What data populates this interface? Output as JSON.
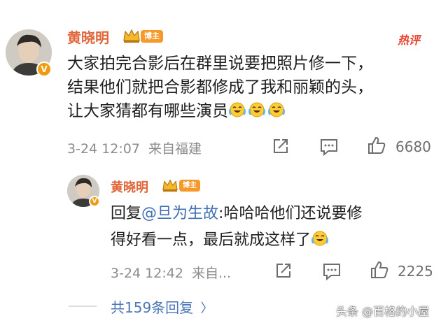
{
  "comment": {
    "user": "黄晓明",
    "badge": "博主",
    "hot_label": "热评",
    "verified_mark": "V",
    "text_lines": [
      "大家拍完合影后在群里说要把照片修一下，",
      "结果他们就把合影都修成了我和丽颖的头，",
      "让大家猜都有哪些演员"
    ],
    "time": "3-24 12:07",
    "location": "来自福建",
    "likes": "6680"
  },
  "reply": {
    "user": "黄晓明",
    "badge": "博主",
    "prefix": "回复",
    "mention": "@旦为生故",
    "text_line1": ":哈哈哈他们还说要修",
    "text_line2": "得好看一点，最后就成这样了",
    "time": "3-24 12:42",
    "location": "来自...",
    "likes": "2225"
  },
  "more_replies": "共159条回复",
  "more_chevron": "〉",
  "watermark": "头条 @百格的小屋",
  "colors": {
    "name": "#e0663a",
    "badge": "#f59a2a",
    "hot": "#e8412c",
    "link": "#3f6fb6",
    "emoji": "#ffcc33"
  }
}
